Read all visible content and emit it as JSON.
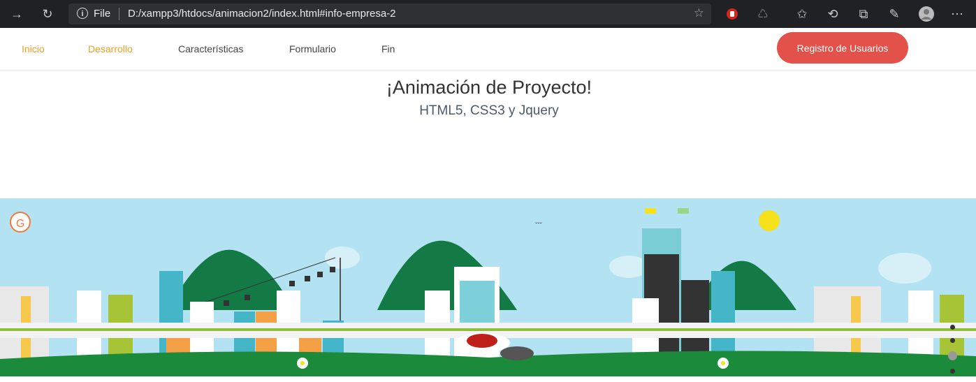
{
  "browser": {
    "protocol_label": "File",
    "url": "D:/xampp3/htdocs/animacion2/index.html#info-empresa-2"
  },
  "nav": {
    "items": [
      {
        "label": "Inicio"
      },
      {
        "label": "Desarrollo"
      },
      {
        "label": "Características"
      },
      {
        "label": "Formulario"
      },
      {
        "label": "Fin"
      }
    ],
    "register_label": "Registro de Usuarios"
  },
  "hero": {
    "title": "¡Animación de Proyecto!",
    "subtitle": "HTML5, CSS3 y Jquery"
  },
  "colors": {
    "accent_orange": "#f0a020",
    "button_red": "#e2524a",
    "sky": "#b3e3f2",
    "grass": "#1b8a3a"
  }
}
